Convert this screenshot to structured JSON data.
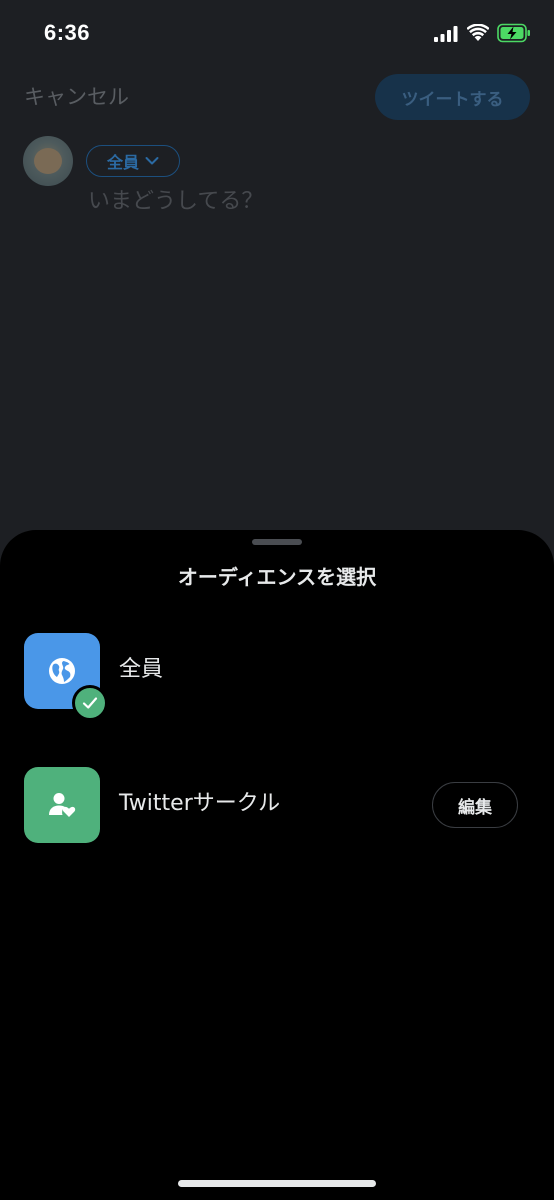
{
  "status_bar": {
    "time": "6:36",
    "icons": [
      "signal-icon",
      "wifi-icon",
      "battery-charging-icon"
    ]
  },
  "compose": {
    "cancel_label": "キャンセル",
    "tweet_label": "ツイートする",
    "audience_chip_label": "全員",
    "placeholder": "いまどうしてる？"
  },
  "sheet": {
    "title": "オーディエンスを選択",
    "options": [
      {
        "label": "全員",
        "icon": "globe-icon",
        "icon_color": "#4a97e8",
        "selected": true
      },
      {
        "label": "Twitterサークル",
        "icon": "person-heart-icon",
        "icon_color": "#4fb17c",
        "selected": false,
        "edit_label": "編集"
      }
    ]
  },
  "colors": {
    "accent_blue": "#1d9bf0",
    "selected_green": "#4fb17c",
    "sheet_background": "#000000",
    "compose_background": "#1d1f23"
  }
}
